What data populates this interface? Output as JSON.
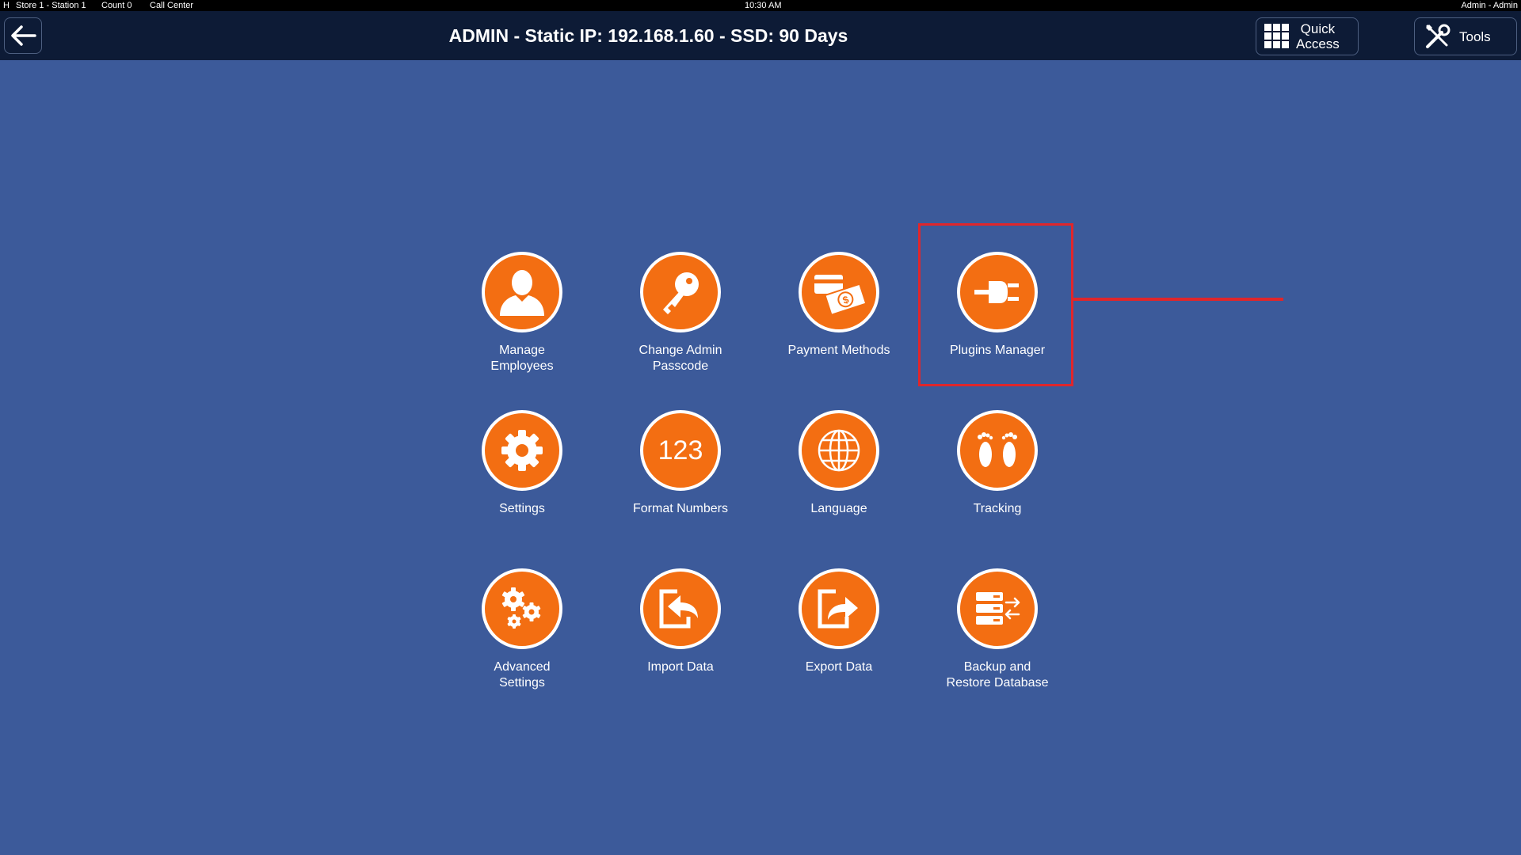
{
  "status": {
    "mode": "H",
    "store": "Store 1 - Station 1",
    "count": "Count 0",
    "call_center": "Call Center",
    "time": "10:30 AM",
    "user": "Admin - Admin"
  },
  "header": {
    "title": "ADMIN - Static IP: 192.168.1.60 - SSD: 90 Days",
    "quick_access_line1": "Quick",
    "quick_access_line2": "Access",
    "tools_label": "Tools"
  },
  "tiles": [
    {
      "label": "Manage\nEmployees",
      "icon": "person-icon"
    },
    {
      "label": "Change Admin\nPasscode",
      "icon": "key-icon"
    },
    {
      "label": "Payment Methods",
      "icon": "payment-icon"
    },
    {
      "label": "Plugins Manager",
      "icon": "plug-icon"
    },
    {
      "label": "Settings",
      "icon": "gear-icon"
    },
    {
      "label": "Format Numbers",
      "icon": "numbers-icon",
      "glyph": "123"
    },
    {
      "label": "Language",
      "icon": "globe-icon"
    },
    {
      "label": "Tracking",
      "icon": "footprints-icon"
    },
    {
      "label": "Advanced\nSettings",
      "icon": "gears-icon"
    },
    {
      "label": "Import Data",
      "icon": "import-icon"
    },
    {
      "label": "Export Data",
      "icon": "export-icon"
    },
    {
      "label": "Backup and\nRestore Database",
      "icon": "database-icon"
    }
  ],
  "colors": {
    "background": "#3c5a9a",
    "header": "#0d1b36",
    "accent": "#f36e12",
    "highlight": "#e0262b"
  }
}
